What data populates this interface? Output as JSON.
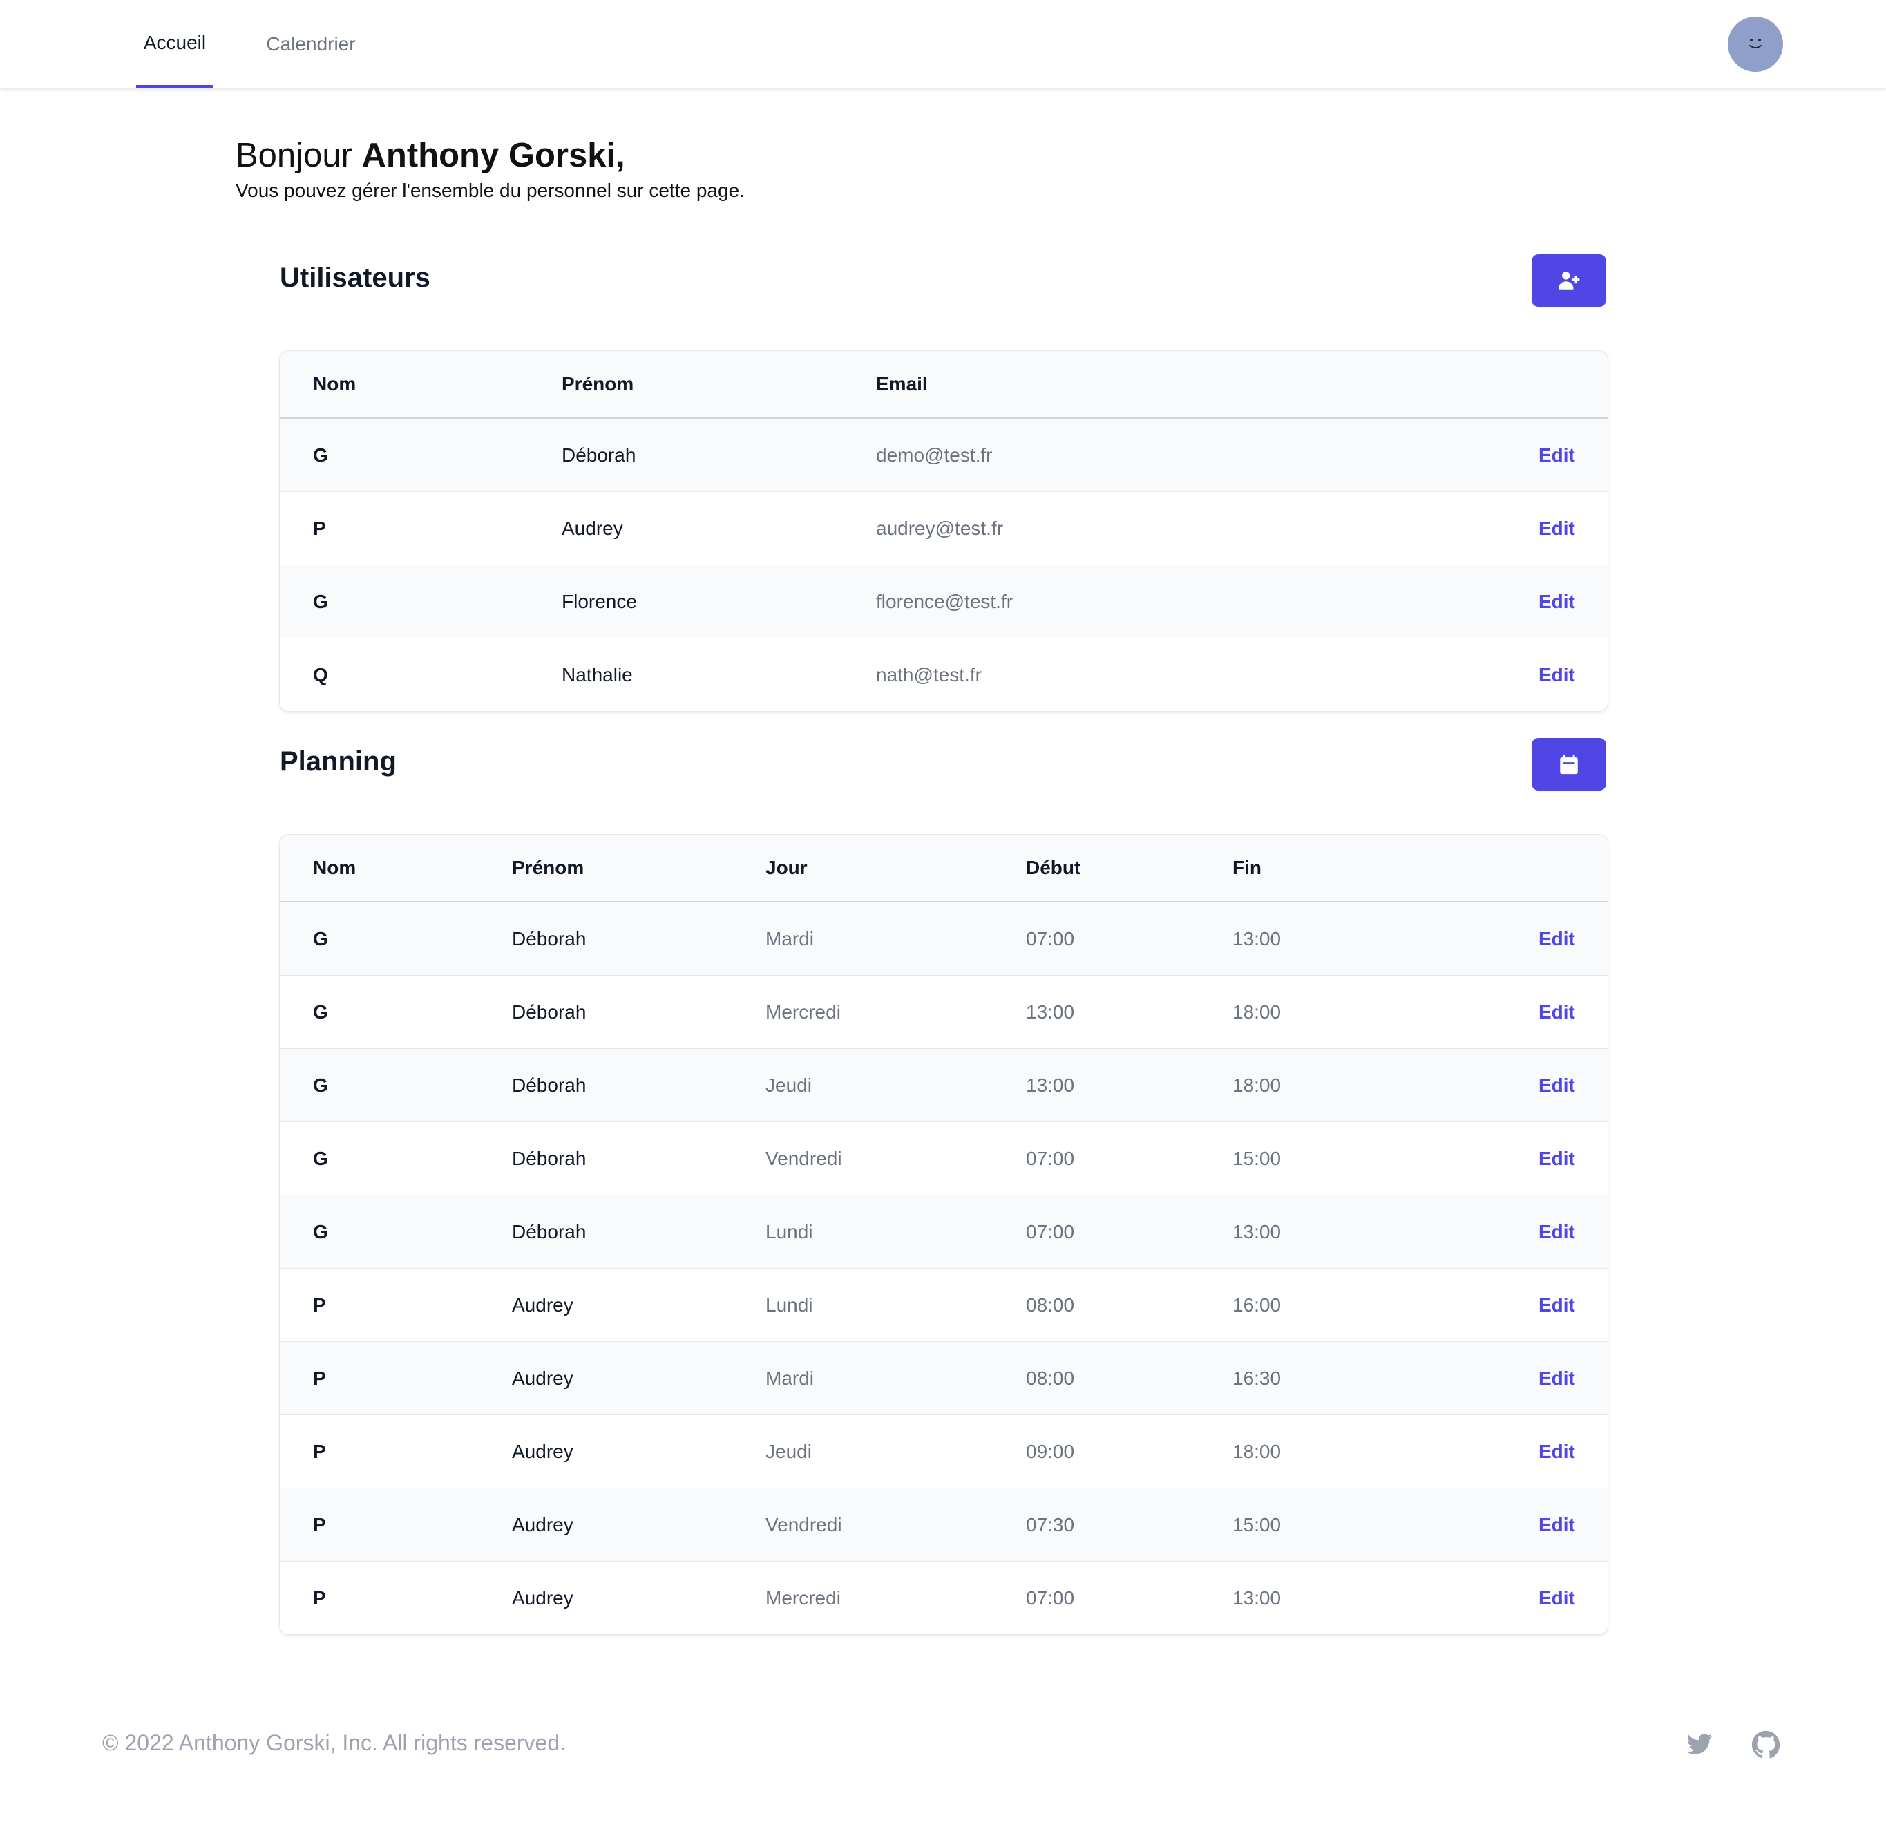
{
  "nav": {
    "tabs": [
      {
        "label": "Accueil"
      },
      {
        "label": "Calendrier"
      }
    ]
  },
  "greeting": {
    "prefix": "Bonjour",
    "name": "Anthony Gorski,",
    "subtitle": "Vous pouvez gérer l'ensemble du personnel sur cette page."
  },
  "users": {
    "title": "Utilisateurs",
    "add_icon": "user-plus-icon",
    "headers": {
      "nom": "Nom",
      "prenom": "Prénom",
      "email": "Email"
    },
    "rows": [
      {
        "nom": "G",
        "prenom": "Déborah",
        "email": "demo@test.fr",
        "action": "Edit"
      },
      {
        "nom": "P",
        "prenom": "Audrey",
        "email": "audrey@test.fr",
        "action": "Edit"
      },
      {
        "nom": "G",
        "prenom": "Florence",
        "email": "florence@test.fr",
        "action": "Edit"
      },
      {
        "nom": "Q",
        "prenom": "Nathalie",
        "email": "nath@test.fr",
        "action": "Edit"
      }
    ]
  },
  "planning": {
    "title": "Planning",
    "add_icon": "calendar-icon",
    "headers": {
      "nom": "Nom",
      "prenom": "Prénom",
      "jour": "Jour",
      "debut": "Début",
      "fin": "Fin"
    },
    "rows": [
      {
        "nom": "G",
        "prenom": "Déborah",
        "jour": "Mardi",
        "debut": "07:00",
        "fin": "13:00",
        "action": "Edit"
      },
      {
        "nom": "G",
        "prenom": "Déborah",
        "jour": "Mercredi",
        "debut": "13:00",
        "fin": "18:00",
        "action": "Edit"
      },
      {
        "nom": "G",
        "prenom": "Déborah",
        "jour": "Jeudi",
        "debut": "13:00",
        "fin": "18:00",
        "action": "Edit"
      },
      {
        "nom": "G",
        "prenom": "Déborah",
        "jour": "Vendredi",
        "debut": "07:00",
        "fin": "15:00",
        "action": "Edit"
      },
      {
        "nom": "G",
        "prenom": "Déborah",
        "jour": "Lundi",
        "debut": "07:00",
        "fin": "13:00",
        "action": "Edit"
      },
      {
        "nom": "P",
        "prenom": "Audrey",
        "jour": "Lundi",
        "debut": "08:00",
        "fin": "16:00",
        "action": "Edit"
      },
      {
        "nom": "P",
        "prenom": "Audrey",
        "jour": "Mardi",
        "debut": "08:00",
        "fin": "16:30",
        "action": "Edit"
      },
      {
        "nom": "P",
        "prenom": "Audrey",
        "jour": "Jeudi",
        "debut": "09:00",
        "fin": "18:00",
        "action": "Edit"
      },
      {
        "nom": "P",
        "prenom": "Audrey",
        "jour": "Vendredi",
        "debut": "07:30",
        "fin": "15:00",
        "action": "Edit"
      },
      {
        "nom": "P",
        "prenom": "Audrey",
        "jour": "Mercredi",
        "debut": "07:00",
        "fin": "13:00",
        "action": "Edit"
      }
    ]
  },
  "footer": {
    "copyright": "© 2022 Anthony Gorski, Inc. All rights reserved.",
    "social_icons": [
      "twitter-icon",
      "github-icon"
    ]
  },
  "colors": {
    "accent": "#4f46e5",
    "avatar": "#8f9fc9",
    "muted_text": "#6b7280",
    "footer_text": "#9ca3af"
  }
}
